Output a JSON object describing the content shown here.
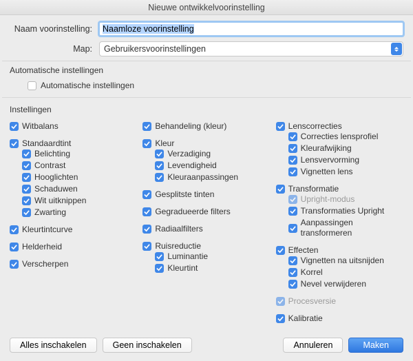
{
  "window": {
    "title": "Nieuwe ontwikkelvoorinstelling"
  },
  "form": {
    "name_label": "Naam voorinstelling:",
    "name_value": "Naamloze voorinstelling",
    "folder_label": "Map:",
    "folder_value": "Gebruikersvoorinstellingen"
  },
  "auto": {
    "heading": "Automatische instellingen",
    "checkbox_label": "Automatische instellingen",
    "checked": false
  },
  "settings": {
    "heading": "Instellingen",
    "columns": [
      [
        {
          "label": "Witbalans",
          "checked": true,
          "children": []
        },
        {
          "label": "Standaardtint",
          "checked": true,
          "children": [
            {
              "label": "Belichting",
              "checked": true
            },
            {
              "label": "Contrast",
              "checked": true
            },
            {
              "label": "Hooglichten",
              "checked": true
            },
            {
              "label": "Schaduwen",
              "checked": true
            },
            {
              "label": "Wit uitknippen",
              "checked": true
            },
            {
              "label": "Zwarting",
              "checked": true
            }
          ]
        },
        {
          "label": "Kleurtintcurve",
          "checked": true,
          "children": []
        },
        {
          "label": "Helderheid",
          "checked": true,
          "children": []
        },
        {
          "label": "Verscherpen",
          "checked": true,
          "children": []
        }
      ],
      [
        {
          "label": "Behandeling (kleur)",
          "checked": true,
          "children": []
        },
        {
          "label": "Kleur",
          "checked": true,
          "children": [
            {
              "label": "Verzadiging",
              "checked": true
            },
            {
              "label": "Levendigheid",
              "checked": true
            },
            {
              "label": "Kleuraanpassingen",
              "checked": true
            }
          ]
        },
        {
          "label": "Gesplitste tinten",
          "checked": true,
          "children": []
        },
        {
          "label": "Gegradueerde filters",
          "checked": true,
          "children": []
        },
        {
          "label": "Radiaalfilters",
          "checked": true,
          "children": []
        },
        {
          "label": "Ruisreductie",
          "checked": true,
          "children": [
            {
              "label": "Luminantie",
              "checked": true
            },
            {
              "label": "Kleurtint",
              "checked": true
            }
          ]
        }
      ],
      [
        {
          "label": "Lenscorrecties",
          "checked": true,
          "children": [
            {
              "label": "Correcties lensprofiel",
              "checked": true
            },
            {
              "label": "Kleurafwijking",
              "checked": true
            },
            {
              "label": "Lensvervorming",
              "checked": true
            },
            {
              "label": "Vignetten lens",
              "checked": true
            }
          ]
        },
        {
          "label": "Transformatie",
          "checked": true,
          "children": [
            {
              "label": "Upright-modus",
              "checked": true,
              "disabled": true
            },
            {
              "label": "Transformaties Upright",
              "checked": true
            },
            {
              "label": "Aanpassingen transformeren",
              "checked": true
            }
          ]
        },
        {
          "label": "Effecten",
          "checked": true,
          "children": [
            {
              "label": "Vignetten na uitsnijden",
              "checked": true
            },
            {
              "label": "Korrel",
              "checked": true
            },
            {
              "label": "Nevel verwijderen",
              "checked": true
            }
          ]
        },
        {
          "label": "Procesversie",
          "checked": true,
          "disabled": true,
          "children": []
        },
        {
          "label": "Kalibratie",
          "checked": true,
          "children": []
        }
      ]
    ]
  },
  "buttons": {
    "check_all": "Alles inschakelen",
    "check_none": "Geen inschakelen",
    "cancel": "Annuleren",
    "create": "Maken"
  }
}
